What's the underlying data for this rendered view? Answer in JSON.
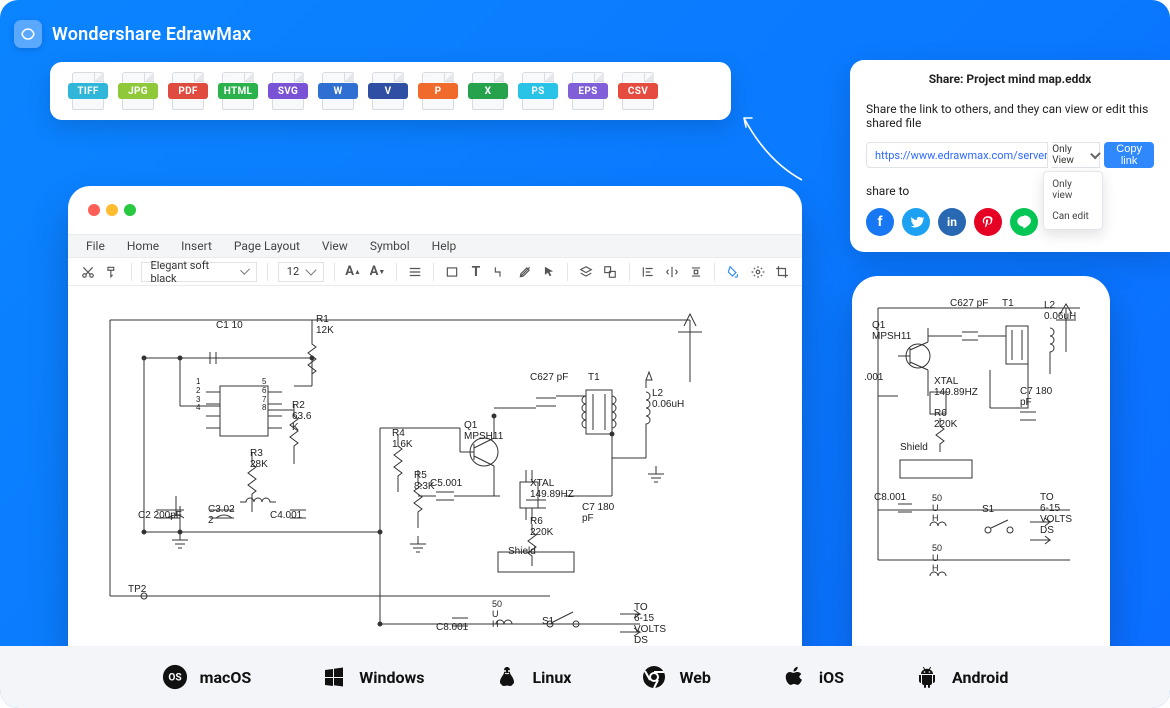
{
  "brand": {
    "name": "Wondershare EdrawMax"
  },
  "exportFormats": [
    {
      "label": "TIFF",
      "color": "#2fb6d9"
    },
    {
      "label": "JPG",
      "color": "#8fc93a"
    },
    {
      "label": "PDF",
      "color": "#e04b3f"
    },
    {
      "label": "HTML",
      "color": "#2bb24c"
    },
    {
      "label": "SVG",
      "color": "#7a52d6"
    },
    {
      "label": "W",
      "color": "#2f6fd1"
    },
    {
      "label": "V",
      "color": "#2e4fa3"
    },
    {
      "label": "P",
      "color": "#ef6a2b"
    },
    {
      "label": "X",
      "color": "#27a24c"
    },
    {
      "label": "PS",
      "color": "#29c3e8"
    },
    {
      "label": "EPS",
      "color": "#815fd9"
    },
    {
      "label": "CSV",
      "color": "#e54b3f"
    }
  ],
  "share": {
    "title": "Share: Project mind map.eddx",
    "desc": "Share the link to others, and they can view or edit this shared file",
    "url": "https://www.edrawmax.com/server/public/...",
    "perm": "Only View",
    "copy": "Copy link",
    "dropdown": [
      "Only view",
      "Can edit"
    ],
    "to_label": "share to",
    "icons": [
      {
        "name": "facebook",
        "bg": "#1877f2"
      },
      {
        "name": "twitter",
        "bg": "#1da1f2"
      },
      {
        "name": "linkedin",
        "bg": "#2867b2"
      },
      {
        "name": "pinterest",
        "bg": "#e60023"
      },
      {
        "name": "line",
        "bg": "#06c755"
      }
    ]
  },
  "window": {
    "menus": [
      "File",
      "Home",
      "Insert",
      "Page Layout",
      "View",
      "Symbol",
      "Help"
    ],
    "font": "Elegant soft black",
    "fontSize": "12"
  },
  "platforms": [
    "macOS",
    "Windows",
    "Linux",
    "Web",
    "iOS",
    "Android"
  ],
  "circuit": {
    "C1": "C1 10",
    "R1": "R1\n12K",
    "R2": "R2\n63.6\nK",
    "R3": "R3\n28K",
    "R4": "R4\n1.6K",
    "R5": "R5\n8.3K",
    "C2": "C2 200pF",
    "C3": "C3.02\n2",
    "C4": "C4.001",
    "C5": "C5.001",
    "Q1": "Q1\nMPSH11",
    "Q1b": "Q1\nMPSH11",
    "C627": "C627 pF",
    "T1": "T1",
    "L2": "L2\n0.06uH",
    "XTAL": "XTAL\n149.89HZ",
    "R6": "R6\n220K",
    "Shield": "Shield",
    "C7": "C7 180\npF",
    "C8": "C8.001",
    "S1": "S1",
    "fifty": "50\nU\nH",
    "V": "TO\n6-15\nVOLTS\nDS",
    "TP2": "TP2",
    "pins": "1\n2\n3\n4",
    "pins58": "5\n6\n7\n8",
    "p001": ".001"
  }
}
